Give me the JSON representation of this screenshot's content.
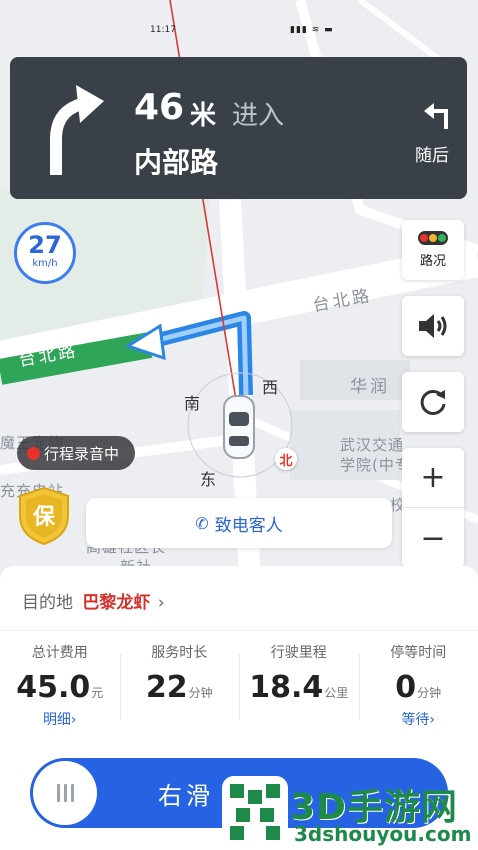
{
  "status_bar": {
    "time": "11:17",
    "icons": "▮▮▮ ≋ ▬"
  },
  "navigation": {
    "distance": "46",
    "distance_unit": "米",
    "action": "进入",
    "road_name": "内部路",
    "then_label": "随后",
    "turn_icon": "turn-right-arrow-icon",
    "then_icon": "turn-left-arrow-icon"
  },
  "speed": {
    "value": "27",
    "unit": "km/h"
  },
  "controls": {
    "traffic_label": "路况",
    "traffic_colors": [
      "#e8322c",
      "#f2b431",
      "#34b35a"
    ],
    "sound_icon": "speaker-icon",
    "refresh_icon": "refresh-icon",
    "zoom_in": "+",
    "zoom_out": "−"
  },
  "map": {
    "road_label_1": "台北路",
    "road_label_2": "台北路",
    "poi_1": "华润",
    "poi_2": "武汉交通",
    "poi_3": "学院(中专",
    "poi_4": "校",
    "poi_5": "魔王宠物",
    "poi_6": "充充电站",
    "poi_7": "高雄社区长",
    "poi_8": "新社",
    "compass": {
      "south": "南",
      "west": "西",
      "east": "东",
      "north": "北"
    }
  },
  "recording": {
    "label": "行程录音中"
  },
  "shield": {
    "label": "保"
  },
  "call": {
    "label": "致电客人",
    "icon": "phone-icon"
  },
  "panel": {
    "destination_prefix": "目的地",
    "destination_name": "巴黎龙虾",
    "destination_chevron": "›",
    "stats": [
      {
        "label": "总计费用",
        "value": "45.0",
        "unit": "元",
        "link": "明细›"
      },
      {
        "label": "服务时长",
        "value": "22",
        "unit": "分钟",
        "link": ""
      },
      {
        "label": "行驶里程",
        "value": "18.4",
        "unit": "公里",
        "link": ""
      },
      {
        "label": "停等时间",
        "value": "0",
        "unit": "分钟",
        "link": "等待›"
      }
    ],
    "slide_text": "右滑 结束"
  },
  "watermark": {
    "title": "3D手游网",
    "url": "3dshouyou.com"
  }
}
